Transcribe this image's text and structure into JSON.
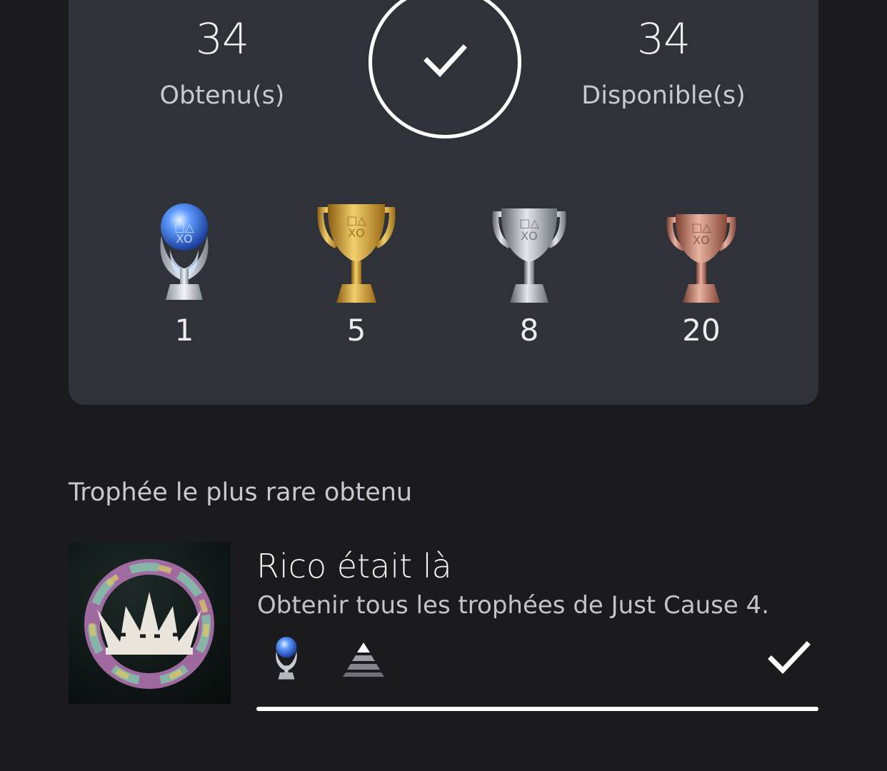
{
  "summary": {
    "earned": {
      "value": "34",
      "label": "Obtenu(s)"
    },
    "available": {
      "value": "34",
      "label": "Disponible(s)"
    },
    "completion_state": "complete",
    "tiers": [
      {
        "name": "platinum",
        "count": "1",
        "icon": "platinum-trophy-icon"
      },
      {
        "name": "gold",
        "count": "5",
        "icon": "gold-trophy-icon"
      },
      {
        "name": "silver",
        "count": "8",
        "icon": "silver-trophy-icon"
      },
      {
        "name": "bronze",
        "count": "20",
        "icon": "bronze-trophy-icon"
      }
    ]
  },
  "rarest": {
    "section_title": "Trophée le plus rare obtenu",
    "trophy": {
      "name": "Rico était là",
      "description": "Obtenir tous les trophées de Just Cause 4.",
      "grade_icon": "platinum-trophy-icon",
      "rarity_icon": "rarity-pyramid-icon",
      "status_icon": "check-icon",
      "progress": 1.0
    }
  },
  "colors": {
    "background": "#1b1b1f",
    "card": "#30323a",
    "platinum": "#5f9bff",
    "gold": "#d9a53a",
    "silver": "#b9bcc2",
    "bronze": "#c47e6a"
  }
}
